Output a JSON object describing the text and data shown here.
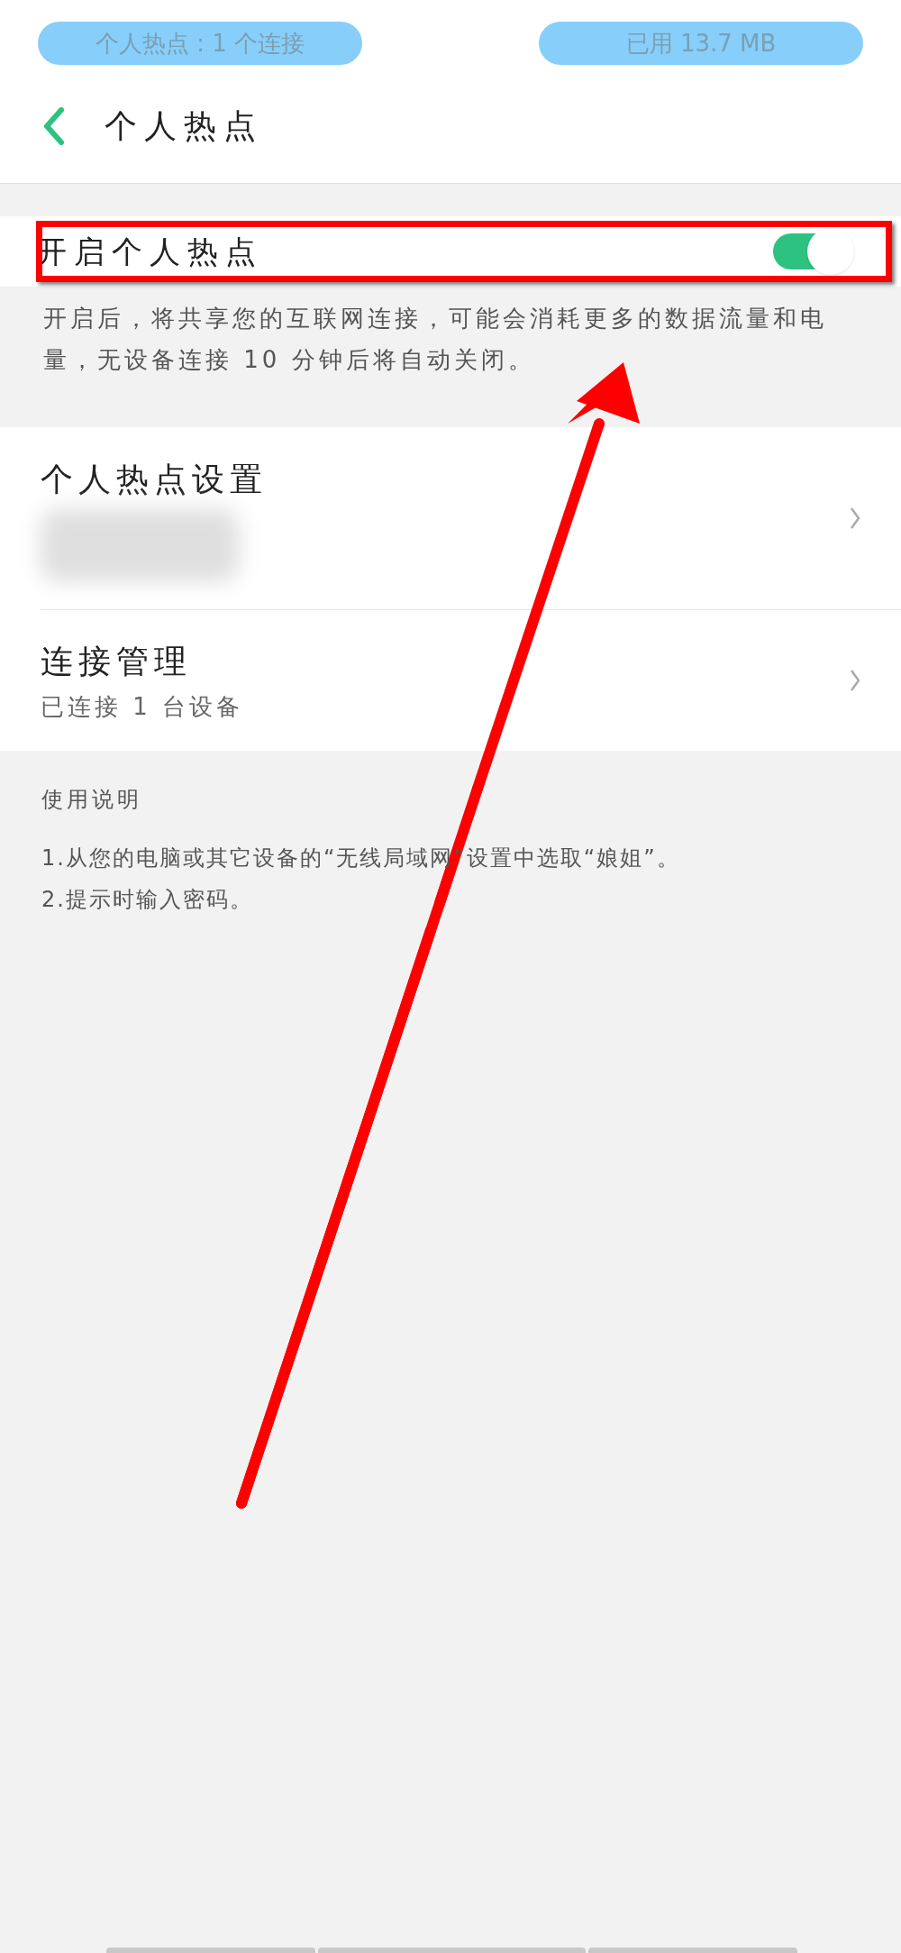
{
  "status_bar": {
    "hotspot_pill": "个人热点 : 1 个连接",
    "data_pill": "已用 13.7 MB"
  },
  "header": {
    "title": "个人热点"
  },
  "toggle_row": {
    "label": "开启个人热点",
    "on": true,
    "highlighted": true
  },
  "description": "开启后，将共享您的互联网连接，可能会消耗更多的数据流量和电量，无设备连接 10 分钟后将自动关闭。",
  "settings_rows": [
    {
      "title": "个人热点设置",
      "subtitle_blurred": true
    },
    {
      "title": "连接管理",
      "subtitle": "已连接 1 台设备"
    }
  ],
  "instructions": {
    "heading": "使用说明",
    "lines": [
      "1.从您的电脑或其它设备的“无线局域网”设置中选取“娘姐”。",
      "2.提示时输入密码。"
    ]
  }
}
